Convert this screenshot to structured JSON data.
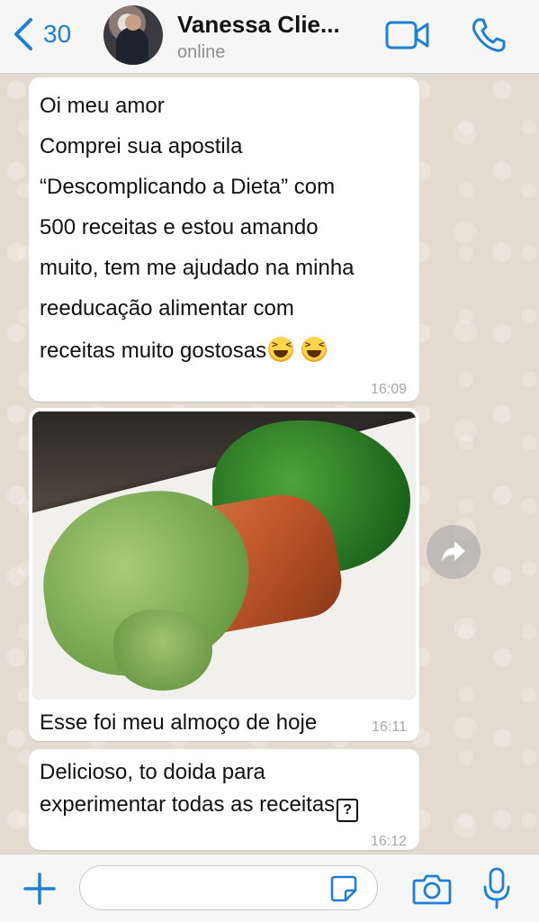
{
  "header": {
    "back_count": "30",
    "contact_name": "Vanessa Clie...",
    "contact_status": "online"
  },
  "messages": [
    {
      "lines": [
        "Oi meu amor",
        "Comprei sua apostila",
        "“Descomplicando a Dieta” com",
        "500 receitas e estou amando",
        "muito, tem me ajudado na minha",
        "reeducação alimentar com",
        "receitas muito gostosas"
      ],
      "emojis": [
        "grinning-squinting-face",
        "grinning-squinting-face"
      ],
      "time": "16:09"
    },
    {
      "type": "image",
      "image_alt": "salmon with green sauce and greens",
      "caption": "Esse foi meu almoço de hoje",
      "time": "16:11"
    },
    {
      "lines": [
        "Delicioso, to doida para",
        "experimentar todas as receitas"
      ],
      "trailing_glyph": "?",
      "time": "16:12"
    }
  ],
  "input": {
    "value": "",
    "placeholder": ""
  },
  "colors": {
    "accent": "#1e7fd6",
    "bubble": "#ffffff",
    "chat_background": "#e3dbd0",
    "timestamp": "#a8a8a8"
  },
  "icons": {
    "back": "chevron-left-icon",
    "video": "video-camera-icon",
    "phone": "phone-icon",
    "forward": "forward-arrow-icon",
    "plus": "plus-icon",
    "sticker": "sticker-icon",
    "camera": "camera-icon",
    "mic": "microphone-icon"
  }
}
